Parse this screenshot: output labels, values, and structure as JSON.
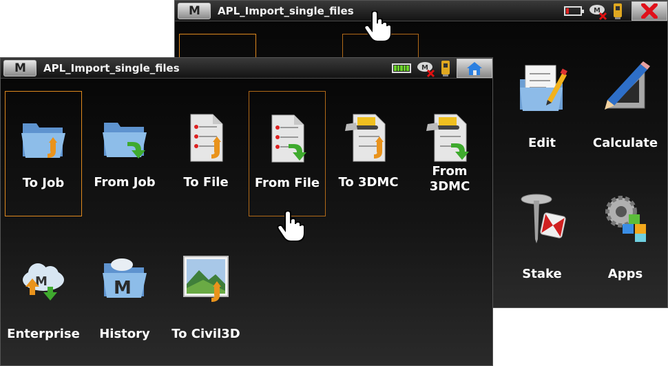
{
  "back_window": {
    "title": "APL_Import_single_files",
    "menu_key": "M",
    "tiles": [
      {
        "label": "Edit",
        "icon": "edit-note-icon"
      },
      {
        "label": "Calculate",
        "icon": "ruler-pencil-icon"
      },
      {
        "label": "Stake",
        "icon": "stake-pin-icon"
      },
      {
        "label": "Apps",
        "icon": "gear-apps-icon"
      }
    ],
    "status_icons": [
      "battery-low-icon",
      "cloud-disconnected-icon",
      "instrument-icon",
      "close-icon"
    ]
  },
  "front_window": {
    "title": "APL_Import_single_files",
    "menu_key": "M",
    "tiles": [
      {
        "label": "To Job",
        "icon": "folder-import-icon",
        "selected": true
      },
      {
        "label": "From Job",
        "icon": "folder-export-icon"
      },
      {
        "label": "To File",
        "icon": "file-import-icon"
      },
      {
        "label": "From File",
        "icon": "file-export-icon",
        "hovered": true
      },
      {
        "label": "To 3DMC",
        "icon": "machine-import-icon"
      },
      {
        "label": "From 3DMC",
        "icon": "machine-export-icon"
      },
      {
        "label": "Enterprise",
        "icon": "cloud-sync-icon"
      },
      {
        "label": "History",
        "icon": "history-folder-icon"
      },
      {
        "label": "To Civil3D",
        "icon": "landscape-import-icon"
      }
    ],
    "status_icons": [
      "battery-full-icon",
      "cloud-disconnected-icon",
      "instrument-icon",
      "home-icon"
    ]
  },
  "colors": {
    "selection_border": "#e08a1e",
    "folder_blue": "#7aaedf",
    "import_arrow_orange": "#e9931c",
    "export_arrow_green": "#3faa2e"
  }
}
